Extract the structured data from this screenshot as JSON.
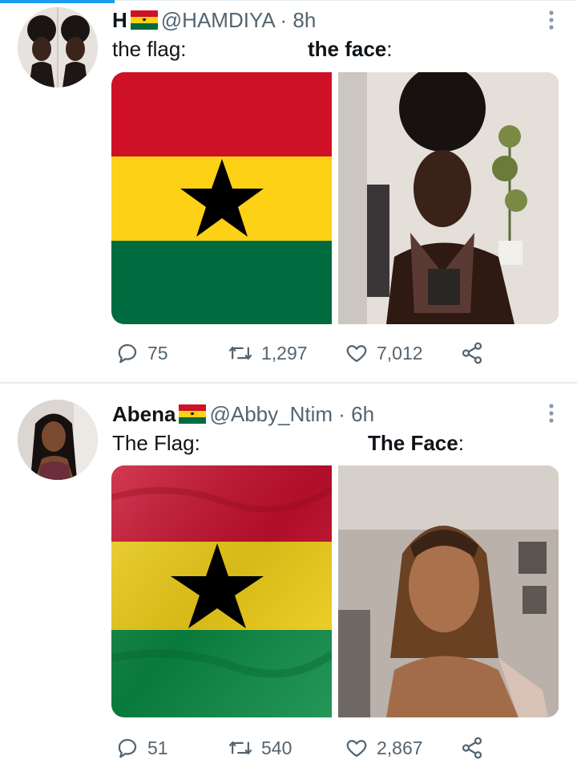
{
  "tweets": [
    {
      "display_name": "H",
      "handle": "@HAMDIYA",
      "separator": "·",
      "time": "8h",
      "caption_left": "the flag:",
      "caption_right_bold": "the face",
      "caption_right_colon": ":",
      "reply_count": "75",
      "retweet_count": "1,297",
      "like_count": "7,012"
    },
    {
      "display_name": "Abena",
      "handle": "@Abby_Ntim",
      "separator": "·",
      "time": "6h",
      "caption_left": "The Flag:",
      "caption_right_bold": "The Face",
      "caption_right_colon": ":",
      "reply_count": "51",
      "retweet_count": "540",
      "like_count": "2,867"
    }
  ],
  "icons": {
    "reply": "reply-icon",
    "retweet": "retweet-icon",
    "like": "heart-icon",
    "share": "share-icon",
    "more": "more-vertical-icon",
    "flag": "ghana-flag-emoji"
  },
  "colors": {
    "accent": "#1d9bf0",
    "ghana_red": "#ce1126",
    "ghana_gold": "#fcd116",
    "ghana_green": "#006b3f",
    "star": "#000000",
    "muted_text": "#536471"
  }
}
